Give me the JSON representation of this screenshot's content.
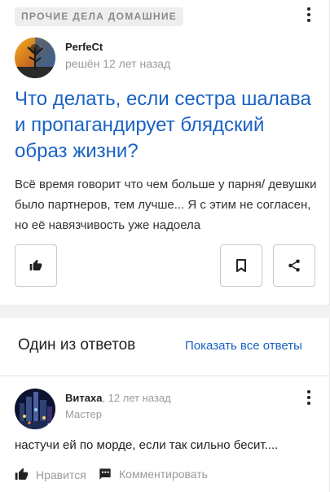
{
  "question": {
    "category": "ПРОЧИЕ ДЕЛА ДОМАШНИЕ",
    "author": "PerfeCt",
    "meta": "решён 12 лет назад",
    "title": "Что делать, если сестра шалава и пропагандирует блядский образ жизни?",
    "body": "Всё время говорит что чем больше у парня/ девушки было партнеров, тем лучше... Я с этим не согласен, но её навязчивость уже надоела"
  },
  "answers": {
    "section_title": "Один из ответов",
    "show_all": "Показать все ответы",
    "author": "Витаха",
    "time": ", 12 лет назад",
    "rank": "Мастер",
    "text": "настучи ей по морде, если так сильно бесит....",
    "like_label": "Нравится",
    "comment_label": "Комментировать"
  },
  "colors": {
    "link": "#1a62c5",
    "muted": "#9a9a9a",
    "text": "#222222"
  },
  "icons": [
    "more-vertical-icon",
    "thumbs-up-icon",
    "bookmark-icon",
    "share-icon",
    "comment-icon"
  ]
}
